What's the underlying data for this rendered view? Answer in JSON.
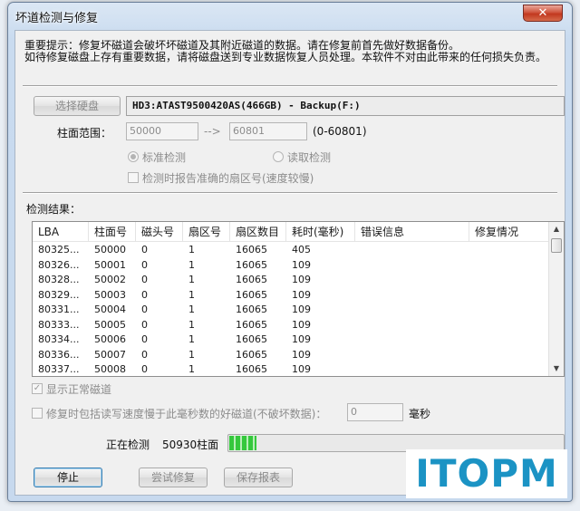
{
  "window": {
    "title": "坏道检测与修复",
    "close_glyph": "✕"
  },
  "notice": {
    "line1": "重要提示：修复坏磁道会破坏坏磁道及其附近磁道的数据。请在修复前首先做好数据备份。",
    "line2": "如待修复磁盘上存有重要数据，请将磁盘送到专业数据恢复人员处理。本软件不对由此带来的任何损失负责。"
  },
  "disk": {
    "select_button": "选择硬盘",
    "selected": "HD3:ATAST9500420AS(466GB) - Backup(F:)"
  },
  "range": {
    "label": "柱面范围：",
    "from": "50000",
    "arrow": "-->",
    "to": "60801",
    "hint": "(0-60801)"
  },
  "mode": {
    "standard": "标准检测",
    "read": "读取检测",
    "selected": "standard",
    "report_sector_label": "检测时报告准确的扇区号(速度较慢)",
    "report_sector_checked": false
  },
  "results": {
    "label": "检测结果：",
    "columns": [
      "LBA",
      "柱面号",
      "磁头号",
      "扇区号",
      "扇区数目",
      "耗时(毫秒)",
      "错误信息",
      "修复情况"
    ],
    "rows": [
      [
        "80325...",
        "50000",
        "0",
        "1",
        "16065",
        "405",
        "",
        ""
      ],
      [
        "80326...",
        "50001",
        "0",
        "1",
        "16065",
        "109",
        "",
        ""
      ],
      [
        "80328...",
        "50002",
        "0",
        "1",
        "16065",
        "109",
        "",
        ""
      ],
      [
        "80329...",
        "50003",
        "0",
        "1",
        "16065",
        "109",
        "",
        ""
      ],
      [
        "80331...",
        "50004",
        "0",
        "1",
        "16065",
        "109",
        "",
        ""
      ],
      [
        "80333...",
        "50005",
        "0",
        "1",
        "16065",
        "109",
        "",
        ""
      ],
      [
        "80334...",
        "50006",
        "0",
        "1",
        "16065",
        "109",
        "",
        ""
      ],
      [
        "80336...",
        "50007",
        "0",
        "1",
        "16065",
        "109",
        "",
        ""
      ],
      [
        "80337...",
        "50008",
        "0",
        "1",
        "16065",
        "109",
        "",
        ""
      ]
    ]
  },
  "options": {
    "show_normal_label": "显示正常磁道",
    "show_normal_checked": true,
    "include_slow_label": "修复时包括读写速度慢于此毫秒数的好磁道(不破坏数据)：",
    "include_slow_checked": false,
    "ms_value": "0",
    "ms_unit": "毫秒"
  },
  "status": {
    "prefix": "正在检测",
    "cylinder": "50930柱面",
    "progress": 0.08
  },
  "buttons": {
    "stop": "停止",
    "try_repair": "尝试修复",
    "save_report": "保存报表"
  },
  "watermark": "ITOPM",
  "colors": {
    "progress": "#35c83d",
    "logo": "#1b93c4"
  }
}
